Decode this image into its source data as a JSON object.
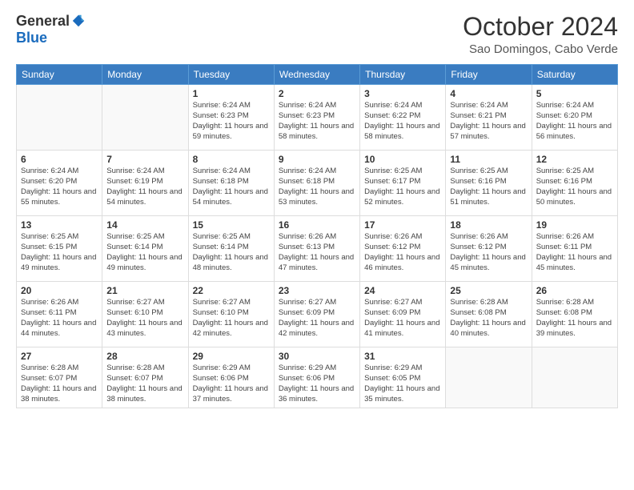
{
  "logo": {
    "general": "General",
    "blue": "Blue"
  },
  "title": "October 2024",
  "location": "Sao Domingos, Cabo Verde",
  "days_of_week": [
    "Sunday",
    "Monday",
    "Tuesday",
    "Wednesday",
    "Thursday",
    "Friday",
    "Saturday"
  ],
  "weeks": [
    [
      {
        "day": "",
        "info": ""
      },
      {
        "day": "",
        "info": ""
      },
      {
        "day": "1",
        "info": "Sunrise: 6:24 AM\nSunset: 6:23 PM\nDaylight: 11 hours and 59 minutes."
      },
      {
        "day": "2",
        "info": "Sunrise: 6:24 AM\nSunset: 6:23 PM\nDaylight: 11 hours and 58 minutes."
      },
      {
        "day": "3",
        "info": "Sunrise: 6:24 AM\nSunset: 6:22 PM\nDaylight: 11 hours and 58 minutes."
      },
      {
        "day": "4",
        "info": "Sunrise: 6:24 AM\nSunset: 6:21 PM\nDaylight: 11 hours and 57 minutes."
      },
      {
        "day": "5",
        "info": "Sunrise: 6:24 AM\nSunset: 6:20 PM\nDaylight: 11 hours and 56 minutes."
      }
    ],
    [
      {
        "day": "6",
        "info": "Sunrise: 6:24 AM\nSunset: 6:20 PM\nDaylight: 11 hours and 55 minutes."
      },
      {
        "day": "7",
        "info": "Sunrise: 6:24 AM\nSunset: 6:19 PM\nDaylight: 11 hours and 54 minutes."
      },
      {
        "day": "8",
        "info": "Sunrise: 6:24 AM\nSunset: 6:18 PM\nDaylight: 11 hours and 54 minutes."
      },
      {
        "day": "9",
        "info": "Sunrise: 6:24 AM\nSunset: 6:18 PM\nDaylight: 11 hours and 53 minutes."
      },
      {
        "day": "10",
        "info": "Sunrise: 6:25 AM\nSunset: 6:17 PM\nDaylight: 11 hours and 52 minutes."
      },
      {
        "day": "11",
        "info": "Sunrise: 6:25 AM\nSunset: 6:16 PM\nDaylight: 11 hours and 51 minutes."
      },
      {
        "day": "12",
        "info": "Sunrise: 6:25 AM\nSunset: 6:16 PM\nDaylight: 11 hours and 50 minutes."
      }
    ],
    [
      {
        "day": "13",
        "info": "Sunrise: 6:25 AM\nSunset: 6:15 PM\nDaylight: 11 hours and 49 minutes."
      },
      {
        "day": "14",
        "info": "Sunrise: 6:25 AM\nSunset: 6:14 PM\nDaylight: 11 hours and 49 minutes."
      },
      {
        "day": "15",
        "info": "Sunrise: 6:25 AM\nSunset: 6:14 PM\nDaylight: 11 hours and 48 minutes."
      },
      {
        "day": "16",
        "info": "Sunrise: 6:26 AM\nSunset: 6:13 PM\nDaylight: 11 hours and 47 minutes."
      },
      {
        "day": "17",
        "info": "Sunrise: 6:26 AM\nSunset: 6:12 PM\nDaylight: 11 hours and 46 minutes."
      },
      {
        "day": "18",
        "info": "Sunrise: 6:26 AM\nSunset: 6:12 PM\nDaylight: 11 hours and 45 minutes."
      },
      {
        "day": "19",
        "info": "Sunrise: 6:26 AM\nSunset: 6:11 PM\nDaylight: 11 hours and 45 minutes."
      }
    ],
    [
      {
        "day": "20",
        "info": "Sunrise: 6:26 AM\nSunset: 6:11 PM\nDaylight: 11 hours and 44 minutes."
      },
      {
        "day": "21",
        "info": "Sunrise: 6:27 AM\nSunset: 6:10 PM\nDaylight: 11 hours and 43 minutes."
      },
      {
        "day": "22",
        "info": "Sunrise: 6:27 AM\nSunset: 6:10 PM\nDaylight: 11 hours and 42 minutes."
      },
      {
        "day": "23",
        "info": "Sunrise: 6:27 AM\nSunset: 6:09 PM\nDaylight: 11 hours and 42 minutes."
      },
      {
        "day": "24",
        "info": "Sunrise: 6:27 AM\nSunset: 6:09 PM\nDaylight: 11 hours and 41 minutes."
      },
      {
        "day": "25",
        "info": "Sunrise: 6:28 AM\nSunset: 6:08 PM\nDaylight: 11 hours and 40 minutes."
      },
      {
        "day": "26",
        "info": "Sunrise: 6:28 AM\nSunset: 6:08 PM\nDaylight: 11 hours and 39 minutes."
      }
    ],
    [
      {
        "day": "27",
        "info": "Sunrise: 6:28 AM\nSunset: 6:07 PM\nDaylight: 11 hours and 38 minutes."
      },
      {
        "day": "28",
        "info": "Sunrise: 6:28 AM\nSunset: 6:07 PM\nDaylight: 11 hours and 38 minutes."
      },
      {
        "day": "29",
        "info": "Sunrise: 6:29 AM\nSunset: 6:06 PM\nDaylight: 11 hours and 37 minutes."
      },
      {
        "day": "30",
        "info": "Sunrise: 6:29 AM\nSunset: 6:06 PM\nDaylight: 11 hours and 36 minutes."
      },
      {
        "day": "31",
        "info": "Sunrise: 6:29 AM\nSunset: 6:05 PM\nDaylight: 11 hours and 35 minutes."
      },
      {
        "day": "",
        "info": ""
      },
      {
        "day": "",
        "info": ""
      }
    ]
  ]
}
